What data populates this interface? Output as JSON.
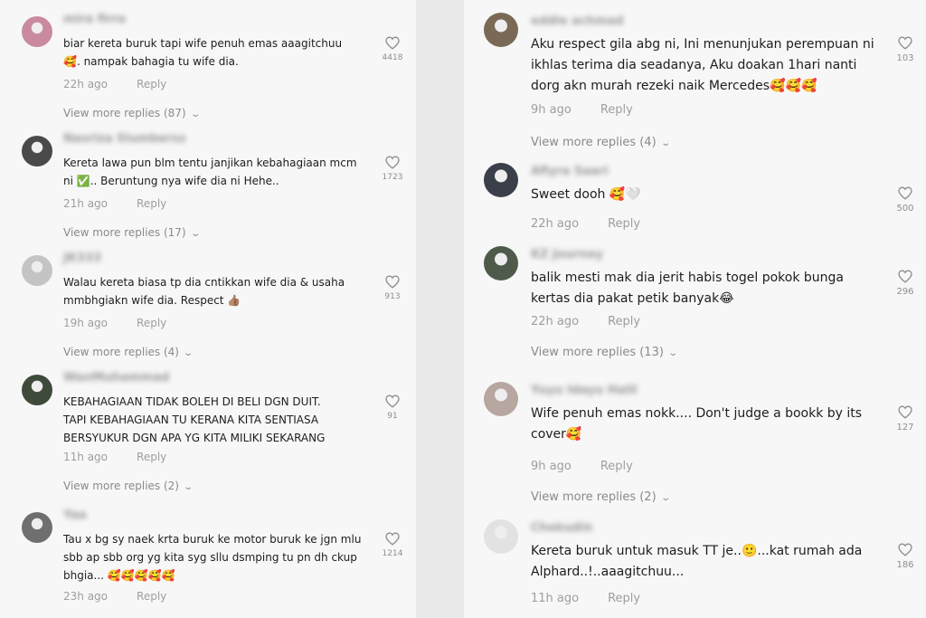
{
  "left": [
    {
      "username": "mira firra",
      "text": "biar kereta buruk tapi wife penuh emas aaagitchuu 🥰. nampak bahagia tu wife dia.",
      "time": "22h ago",
      "reply": "Reply",
      "likes": "4418",
      "replies": "View more replies (87)",
      "avatar_color": "#c98aa0"
    },
    {
      "username": "Nasriza Slumberss",
      "text": "Kereta lawa pun blm tentu janjikan kebahagiaan mcm ni ✅.. Beruntung nya wife dia ni Hehe..",
      "time": "21h ago",
      "reply": "Reply",
      "likes": "1723",
      "replies": "View more replies (17)",
      "avatar_color": "#4a4a4a"
    },
    {
      "username": "JK333",
      "text": "Walau kereta biasa tp dia cntikkan wife dia & usaha mmbhgiakn wife dia. Respect 👍🏽",
      "time": "19h ago",
      "reply": "Reply",
      "likes": "913",
      "replies": "View more replies (4)",
      "avatar_color": "#c4c4c4"
    },
    {
      "username": "WanMuhammad",
      "text": "KEBAHAGIAAN TIDAK BOLEH DI BELI DGN DUIT.\nTAPI KEBAHAGIAAN TU KERANA KITA SENTIASA\nBERSYUKUR DGN APA YG KITA MILIKI SEKARANG",
      "time": "11h ago",
      "reply": "Reply",
      "likes": "91",
      "replies": "View more replies (2)",
      "avatar_color": "#3f4b3a"
    },
    {
      "username": "Yaa",
      "text": "Tau x bg sy naek krta buruk ke motor buruk ke jgn mlu sbb ap sbb org yg kita syg sllu dsmping tu pn dh ckup bhgia... 🥰🥰🥰🥰🥰",
      "time": "23h ago",
      "reply": "Reply",
      "likes": "1214",
      "replies": "",
      "avatar_color": "#6f6f6f"
    }
  ],
  "right": [
    {
      "username": "eddie achmad",
      "text": "Aku respect gila abg ni, Ini menunjukan perempuan ni ikhlas terima dia seadanya, Aku doakan 1hari nanti dorg akn murah rezeki naik Mercedes🥰🥰🥰",
      "time": "9h ago",
      "reply": "Reply",
      "likes": "103",
      "replies": "View more replies (4)",
      "avatar_color": "#7a6a55"
    },
    {
      "username": "Afiyra Saari",
      "text": "Sweet dooh 🥰🤍",
      "time": "22h ago",
      "reply": "Reply",
      "likes": "500",
      "replies": "",
      "avatar_color": "#3a3f4a"
    },
    {
      "username": "KZ Journey",
      "text": "balik mesti mak dia jerit habis togel pokok bunga kertas dia pakat petik banyak😂",
      "time": "22h ago",
      "reply": "Reply",
      "likes": "296",
      "replies": "View more replies (13)",
      "avatar_color": "#4e5a4a"
    },
    {
      "username": "Yuyu Idayu Halil",
      "text": "Wife penuh emas nokk.... Don't judge a bookk by its cover🥰",
      "time": "9h ago",
      "reply": "Reply",
      "likes": "127",
      "replies": "View more replies (2)",
      "avatar_color": "#b8a6a0"
    },
    {
      "username": "Chekudin",
      "text": "Kereta buruk untuk masuk TT je..🙂...kat rumah ada Alphard..!..aaagitchuu...",
      "time": "11h ago",
      "reply": "Reply",
      "likes": "186",
      "replies": "",
      "avatar_color": "#e2e2e2"
    }
  ]
}
